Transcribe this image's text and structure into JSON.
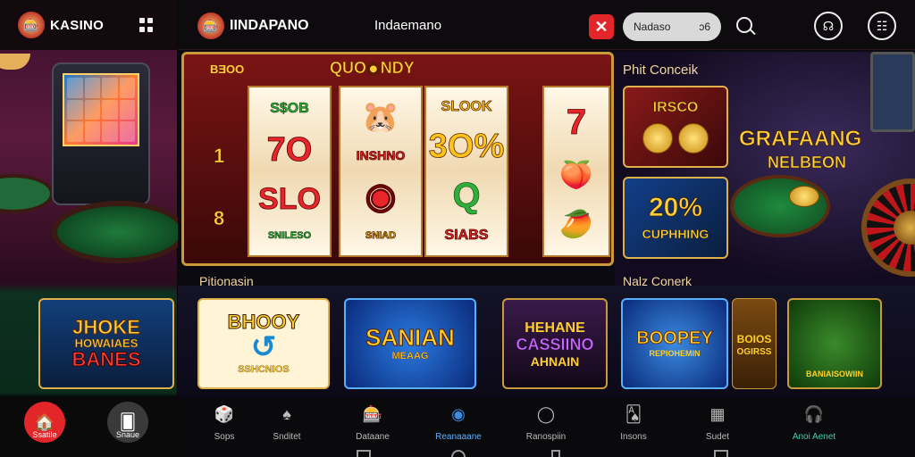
{
  "left_panel": {
    "brand": "KASINO",
    "logo_glyph": "🎰",
    "joker_card": {
      "line1": "JHOKE",
      "line2": "HOWAIAES",
      "line3": "BANES"
    },
    "nav": [
      {
        "label": "Ssatile",
        "icon": "casino-chip-icon",
        "glyph": "🏠",
        "color": "#e2262a"
      },
      {
        "label": "Snaue",
        "icon": "cards-icon",
        "glyph": "🂠",
        "color": "#3a3a3a"
      }
    ]
  },
  "header": {
    "logo_glyph": "🎰",
    "brand": "IINDAPANO",
    "subtitle": "Indaemano",
    "close_glyph": "✕",
    "search_placeholder": "Nadaso",
    "search_suffix": "ɔ6",
    "user_glyph": "☊",
    "menu_glyph": "☷"
  },
  "slot_machine": {
    "top_left": "BƎOO",
    "title": "QUO◉NDY",
    "side_numbers": [
      "1",
      "8"
    ],
    "reels": [
      {
        "symbols": [
          {
            "text": "S$OB",
            "style": "sym-green",
            "size": 16
          },
          {
            "text": "7O",
            "style": "sym-red",
            "size": 38
          },
          {
            "text": "SLO",
            "style": "sym-red",
            "size": 34
          },
          {
            "text": "SNILESO",
            "style": "sym-green",
            "size": 11
          }
        ]
      },
      {
        "symbols": [
          {
            "text": "🐹",
            "style": "sym-gold",
            "size": 34
          },
          {
            "text": "INSHNO",
            "style": "sym-red",
            "size": 14
          },
          {
            "text": "◉",
            "style": "sym-red",
            "size": 40
          },
          {
            "text": "SNIAD",
            "style": "sym-gold",
            "size": 11
          }
        ]
      },
      {
        "symbols": [
          {
            "text": "SLOOK",
            "style": "sym-gold",
            "size": 16
          },
          {
            "text": "3O%",
            "style": "sym-gold",
            "size": 38
          },
          {
            "text": "Q",
            "style": "sym-green",
            "size": 40
          },
          {
            "text": "SIABS",
            "style": "sym-red",
            "size": 16
          }
        ]
      },
      {
        "symbols": [
          {
            "text": "7",
            "style": "sym-red",
            "size": 40
          },
          {
            "text": "🍑",
            "style": "sym-gold",
            "size": 30
          },
          {
            "text": "🥭",
            "style": "sym-gold",
            "size": 30
          }
        ]
      }
    ]
  },
  "promotions": {
    "label": "Pitionasin",
    "cards": [
      {
        "big": "BHOOY",
        "small": "SSHCNIOS",
        "bg": "#fff4d6",
        "color": "#ffcf2a"
      },
      {
        "big": "SANIAN",
        "small": "MEAAG",
        "bg": "#1a5ad0",
        "color": "#ffcf2a"
      },
      {
        "big": "HEHANE",
        "mid": "CASSIINO",
        "small": "AHNAIN",
        "bg": "#2a0a3a",
        "color": "#ffcf2a"
      }
    ]
  },
  "featured": {
    "label_top": "Phit Conceik",
    "card1_text": "IRSCO",
    "card2_big": "20%",
    "card2_small": "CUPHHING",
    "title": "GRAFAANG",
    "subtitle": "NELBEON"
  },
  "live_games": {
    "label": "Nalz Conerk",
    "cards": [
      {
        "big": "BOOPEY",
        "small": "REPIOHEMIN",
        "bg": "#0e4aa8"
      },
      {
        "big": "BOIOS",
        "small": "OGIRSS",
        "bg": "#7a4a12"
      },
      {
        "big": "",
        "small": "BANIAISOWIIN",
        "bg": "#1e5a1a"
      }
    ]
  },
  "bottom_nav": [
    {
      "label": "Sops",
      "icon": "dice-icon",
      "glyph": "🎲",
      "active": false
    },
    {
      "label": "Snditet",
      "icon": "spade-icon",
      "glyph": "♠",
      "active": false
    },
    {
      "label": "Dataane",
      "icon": "slot-icon",
      "glyph": "🎰",
      "active": false
    },
    {
      "label": "Reanaaane",
      "icon": "chip-icon",
      "glyph": "◉",
      "active": true
    },
    {
      "label": "Ranospiin",
      "icon": "search-icon",
      "glyph": "◯",
      "active": false
    },
    {
      "label": "Insons",
      "icon": "card-icon",
      "glyph": "🂡",
      "active": false
    },
    {
      "label": "Sudet",
      "icon": "grid-icon",
      "glyph": "▦",
      "active": false
    },
    {
      "label": "Anoi Aenet",
      "icon": "headset-icon",
      "glyph": "🎧",
      "active": true
    }
  ],
  "colors": {
    "accent_red": "#e2262a",
    "gold": "#ffcf3a",
    "active_nav": "#3ad0b0"
  }
}
